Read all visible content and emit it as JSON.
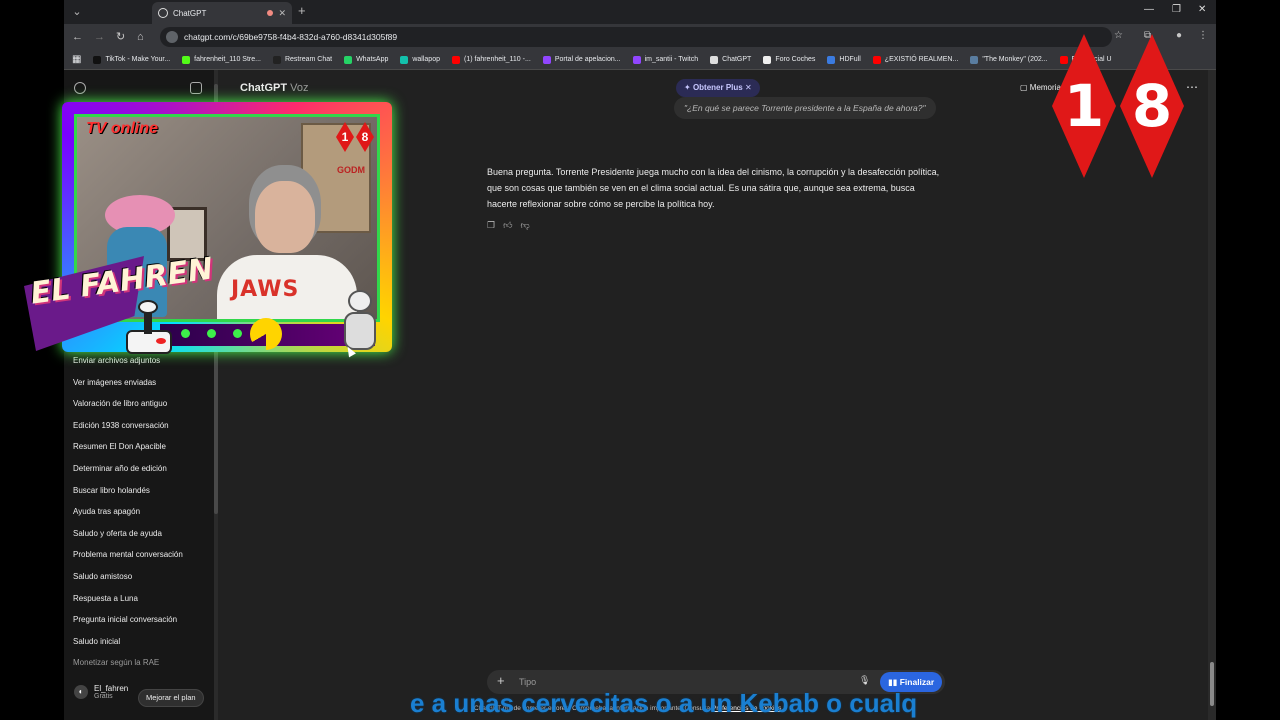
{
  "browser": {
    "tab_title": "ChatGPT",
    "url": "chatgpt.com/c/69be9758-f4b4-832d-a760-d8341d305f89",
    "bookmarks": [
      {
        "label": "TikTok - Make Your...",
        "color": "#111111"
      },
      {
        "label": "fahrenheit_110 Stre...",
        "color": "#53fc18"
      },
      {
        "label": "Restream Chat",
        "color": "#222222"
      },
      {
        "label": "WhatsApp",
        "color": "#25d366"
      },
      {
        "label": "wallapop",
        "color": "#13c1ac"
      },
      {
        "label": "(1) fahrenheit_110 -...",
        "color": "#ff0000"
      },
      {
        "label": "Portal de apelacion...",
        "color": "#9146ff"
      },
      {
        "label": "im_santii - Twitch",
        "color": "#9146ff"
      },
      {
        "label": "ChatGPT",
        "color": "#dddddd"
      },
      {
        "label": "Foro Coches",
        "color": "#eeeeee"
      },
      {
        "label": "HDFull",
        "color": "#3b7be0"
      },
      {
        "label": "¿EXISTIÓ REALMEN...",
        "color": "#ff0000"
      },
      {
        "label": "\"The Monkey\" (202...",
        "color": "#5a7da0"
      },
      {
        "label": "EN Official U",
        "color": "#ff0000"
      }
    ]
  },
  "app": {
    "title": "ChatGPT",
    "mode": "Voz",
    "obtener_plus": "Obtener Plus",
    "memory_label": "Memoria",
    "user_message": "\"¿En qué se parece Torrente presidente a la España de ahora?\"",
    "assistant_reply": "Buena pregunta. Torrente Presidente juega mucho con la idea del cinismo, la corrupción y la desafección política, que son cosas que también se ven en el clima social actual. Es una sátira que, aunque sea extrema, busca hacerte reflexionar sobre cómo se percibe la política hoy.",
    "composer_placeholder": "Tipo",
    "finalizar": "Finalizar",
    "footnote": "ChatGPT puede cometer errores. Comprueba la información importante. Consulta",
    "footnote_link": "Preferencias de cookies."
  },
  "sidebar": {
    "history": [
      "Enviar archivos adjuntos",
      "Ver imágenes enviadas",
      "Valoración de libro antiguo",
      "Edición 1938 conversación",
      "Resumen El Don Apacible",
      "Determinar año de edición",
      "Buscar libro holandés",
      "Ayuda tras apagón",
      "Saludo y oferta de ayuda",
      "Problema mental conversación",
      "Saludo amistoso",
      "Respuesta a Luna",
      "Pregunta inicial conversación",
      "Saludo inicial",
      "Monetizar según la RAE"
    ],
    "user_name": "El_fahren",
    "user_plan": "Gratis",
    "upgrade_label": "Mejorar el plan"
  },
  "overlay": {
    "tv_label": "TV online",
    "age_digits": [
      "1",
      "8"
    ],
    "streamer_logo": "EL FAHREN",
    "shirt_text": "JAWS",
    "poster_text": "GODM",
    "subtitle": "e a unas cervecitas o a un Kebab o cualq"
  }
}
